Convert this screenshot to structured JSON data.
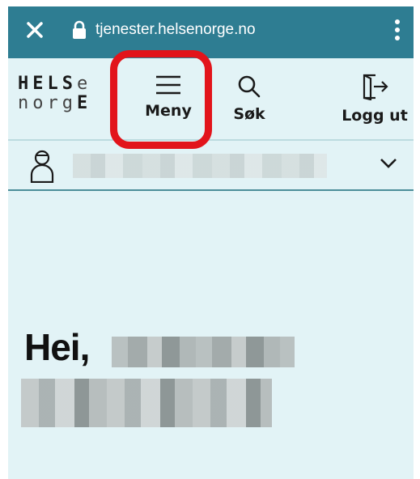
{
  "browser": {
    "url": "tjenester.helsenorge.no",
    "icons": [
      "close-icon",
      "lock-icon",
      "more-vertical-icon"
    ]
  },
  "header": {
    "logo": {
      "line1_bold": "HELS",
      "line1_light": "e",
      "line2_light": "norg",
      "line2_bold": "E"
    },
    "menu_label": "Meny",
    "search_label": "Søk",
    "logout_label": "Logg ut",
    "icons": [
      "menu-icon",
      "search-icon",
      "logout-icon"
    ]
  },
  "userbar": {
    "icons": [
      "user-icon",
      "chevron-down-icon"
    ]
  },
  "main": {
    "greeting": "Hei,"
  },
  "colors": {
    "urlbar": "#2e7d92",
    "background": "#e2f3f6",
    "highlight": "#e2141b"
  }
}
